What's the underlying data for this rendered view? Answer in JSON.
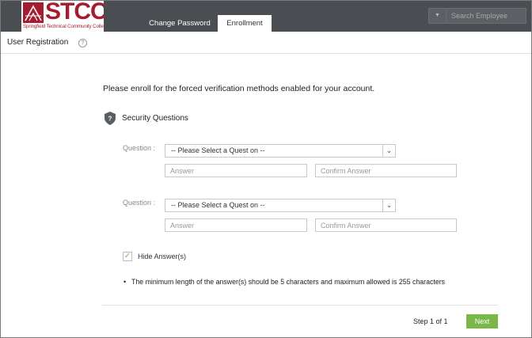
{
  "header": {
    "logo_text": "STCC",
    "logo_subtitle": "Springfield Technical Community College",
    "tabs": [
      {
        "label": "Change Password"
      },
      {
        "label": "Enrollment"
      }
    ],
    "search_placeholder": "Search Employee"
  },
  "subheader": {
    "title": "User Registration",
    "help_glyph": "?"
  },
  "main": {
    "intro": "Please enroll for the forced verification methods enabled for your account.",
    "section_title": "Security Questions",
    "questions": [
      {
        "label": "Question :",
        "selected": "-- Please Select a Quest on --",
        "answer_placeholder": "Answer",
        "confirm_placeholder": "Confirm Answer"
      },
      {
        "label": "Question :",
        "selected": "-- Please Select a Quest on --",
        "answer_placeholder": "Answer",
        "confirm_placeholder": "Confirm Answer"
      }
    ],
    "hide_answers_label": "Hide Answer(s)",
    "hide_answers_checked": true,
    "note": "The minimum length of the answer(s) should be 5 characters and maximum allowed is 255 characters"
  },
  "footer": {
    "step_text": "Step 1 of 1",
    "next_label": "Next"
  },
  "colors": {
    "topbar": "#4a4d51",
    "brand": "#a51c30",
    "accent": "#7ab648"
  }
}
